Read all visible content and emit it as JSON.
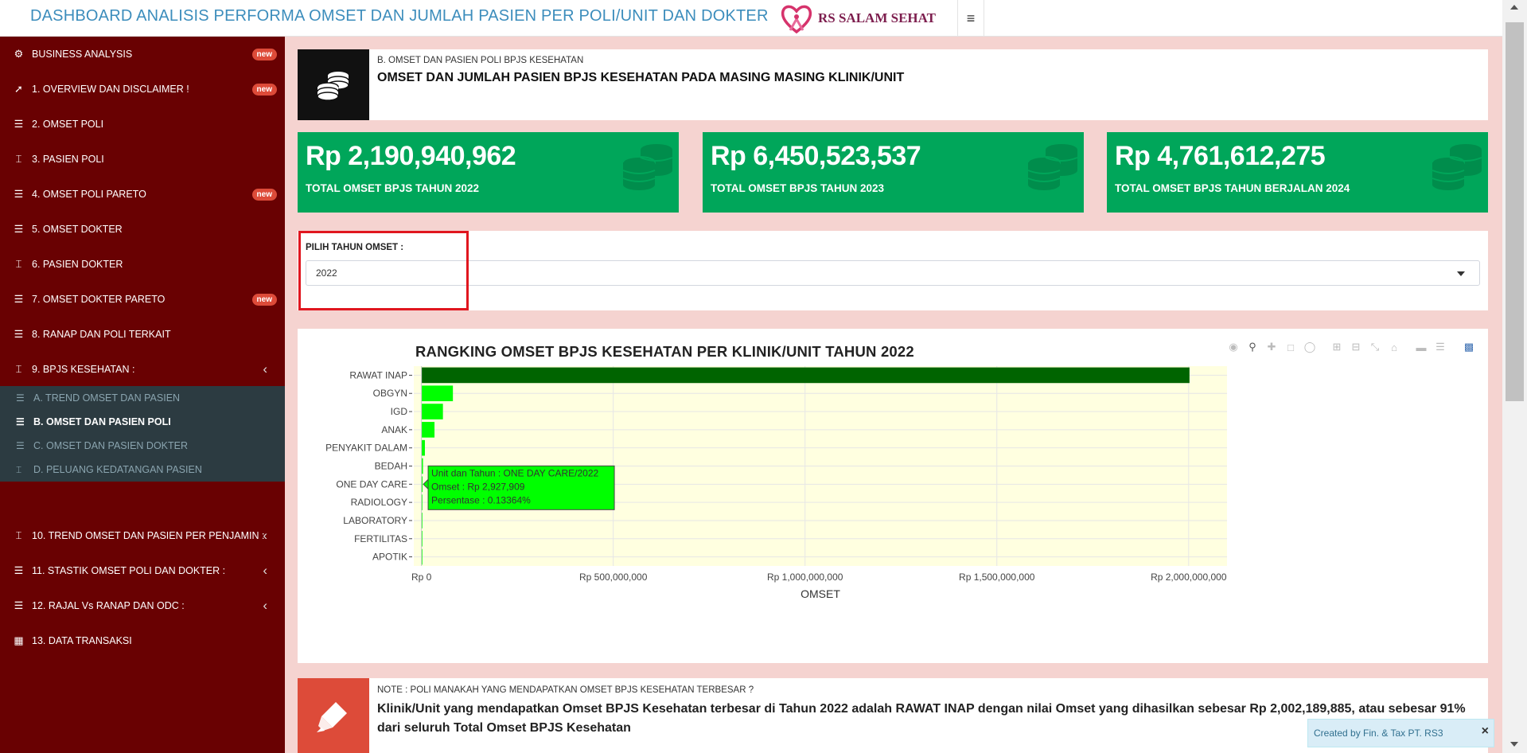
{
  "header": {
    "title": "DASHBOARD ANALISIS PERFORMA OMSET DAN JUMLAH PASIEN PER POLI/UNIT DAN DOKTER",
    "logo_text": "RS SALAM SEHAT",
    "menu_icon": "≡"
  },
  "sidebar": {
    "items": [
      {
        "label": "BUSINESS ANALYSIS",
        "icon": "gear-icon",
        "badge": "new"
      },
      {
        "label": "1. OVERVIEW DAN DISCLAIMER !",
        "icon": "rocket-icon",
        "badge": "new"
      },
      {
        "label": "2. OMSET POLI",
        "icon": "coins-icon",
        "badge": ""
      },
      {
        "label": "3. PASIEN POLI",
        "icon": "bed-icon",
        "badge": ""
      },
      {
        "label": "4. OMSET POLI PARETO",
        "icon": "coins-icon",
        "badge": "new"
      },
      {
        "label": "5. OMSET DOKTER",
        "icon": "coins-icon",
        "badge": ""
      },
      {
        "label": "6. PASIEN DOKTER",
        "icon": "bed-icon",
        "badge": ""
      },
      {
        "label": "7. OMSET DOKTER PARETO",
        "icon": "coins-icon",
        "badge": "new"
      },
      {
        "label": "8. RANAP DAN POLI TERKAIT",
        "icon": "coins-icon",
        "badge": ""
      },
      {
        "label": "9. BPJS KESEHATAN :",
        "icon": "bed-icon",
        "badge": ""
      },
      {
        "label": "10. TREND OMSET DAN PASIEN PER PENJAMIN :",
        "icon": "bed-icon",
        "badge": ""
      },
      {
        "label": "11. STASTIK OMSET POLI DAN DOKTER :",
        "icon": "coins-icon",
        "badge": ""
      },
      {
        "label": "12. RAJAL Vs RANAP DAN ODC :",
        "icon": "coins-icon",
        "badge": ""
      },
      {
        "label": "13. DATA TRANSAKSI",
        "icon": "table-icon",
        "badge": ""
      }
    ],
    "submenu": [
      {
        "label": "A. TREND OMSET DAN PASIEN",
        "icon": "coins-icon"
      },
      {
        "label": "B. OMSET DAN PASIEN POLI",
        "icon": "coins-icon"
      },
      {
        "label": "C. OMSET DAN PASIEN DOKTER",
        "icon": "coins-icon"
      },
      {
        "label": "D. PELUANG KEDATANGAN PASIEN",
        "icon": "bed-icon"
      }
    ]
  },
  "page_header": {
    "subtitle": "B. OMSET DAN PASIEN POLI BPJS KESEHATAN",
    "title": "OMSET DAN JUMLAH PASIEN BPJS KESEHATAN PADA MASING MASING KLINIK/UNIT"
  },
  "kpis": [
    {
      "value": "Rp 2,190,940,962",
      "label": "TOTAL OMSET BPJS TAHUN 2022"
    },
    {
      "value": "Rp 6,450,523,537",
      "label": "TOTAL OMSET BPJS TAHUN 2023"
    },
    {
      "value": "Rp 4,761,612,275",
      "label": "TOTAL OMSET BPJS TAHUN BERJALAN 2024"
    }
  ],
  "filter": {
    "label": "PILIH TAHUN OMSET :",
    "selected": "2022"
  },
  "chart_data": {
    "type": "bar",
    "orientation": "horizontal",
    "title": "RANGKING OMSET BPJS KESEHATAN PER KLINIK/UNIT TAHUN 2022",
    "xlabel": "OMSET",
    "ylabel": "",
    "categories": [
      "RAWAT INAP",
      "OBGYN",
      "IGD",
      "ANAK",
      "PENYAKIT DALAM",
      "BEDAH",
      "ONE DAY CARE",
      "RADIOLOGY",
      "LABORATORY",
      "FERTILITAS",
      "APOTIK"
    ],
    "values": [
      2002189885,
      82000000,
      56000000,
      34000000,
      9000000,
      4000000,
      2927909,
      1800000,
      300000,
      150000,
      80000
    ],
    "xlim": [
      -20000000,
      2100000000
    ],
    "x_ticks": [
      0,
      500000000,
      1000000000,
      1500000000,
      2000000000
    ],
    "x_tick_labels": [
      "Rp 0",
      "Rp 500,000,000",
      "Rp 1,000,000,000",
      "Rp 1,500,000,000",
      "Rp 2,000,000,000"
    ],
    "bar_colors": {
      "top": "#006400",
      "other": "#00ff00"
    },
    "plot_background": "#ffffe0",
    "grid": true,
    "tooltip": {
      "category": "ONE DAY CARE",
      "lines": [
        "Unit dan Tahun : ONE DAY CARE/2022",
        "Omset : Rp 2,927,909",
        "Persentase : 0.13364%"
      ]
    }
  },
  "note": {
    "subtitle": "NOTE : POLI MANAKAH YANG MENDAPATKAN OMSET BPJS KESEHATAN TERBESAR ?",
    "text": "Klinik/Unit yang mendapatkan Omset BPJS Kesehatan terbesar di Tahun 2022 adalah RAWAT INAP dengan nilai Omset yang dihasilkan sebesar Rp 2,002,189,885, atau sebesar 91% dari seluruh Total Omset BPJS Kesehatan"
  },
  "toast": {
    "text": "Created by Fin. & Tax PT. RS3",
    "close": "×"
  },
  "colors": {
    "sidebar": "#690102",
    "submenu": "#2c3b41",
    "kpi": "#00a65a",
    "title_blue": "#3c8dbc",
    "badge": "#dd4b39"
  }
}
